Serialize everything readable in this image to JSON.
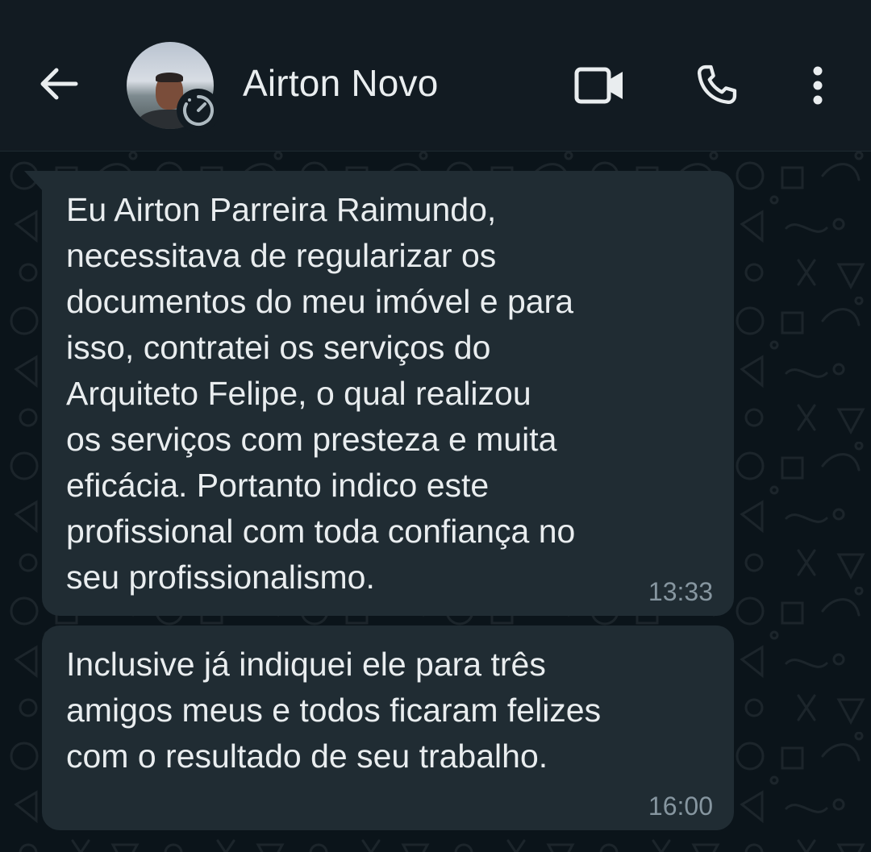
{
  "header": {
    "contact_name": "Airton Novo",
    "back_icon": "arrow-left-icon",
    "video_icon": "video-camera-icon",
    "call_icon": "phone-icon",
    "menu_icon": "more-vertical-icon",
    "status_icon": "status-timer-icon"
  },
  "messages": [
    {
      "text": "Eu Airton Parreira Raimundo,\nnecessitava de regularizar os\ndocumentos do meu imóvel e para\nisso,  contratei os serviços  do\nArquiteto Felipe, o qual realizou\nos serviços com presteza e muita\neficácia. Portanto indico este\nprofissional com toda confiança no\nseu profissionalismo.",
      "time": "13:33"
    },
    {
      "text": "Inclusive já indiquei ele para três\namigos meus e todos ficaram felizes\ncom o resultado de seu trabalho.",
      "time": "16:00"
    }
  ],
  "colors": {
    "header_bg": "#121b22",
    "chat_bg": "#0b141a",
    "bubble_bg": "#202c33",
    "text": "#e9edef",
    "timestamp": "#8696a0"
  }
}
